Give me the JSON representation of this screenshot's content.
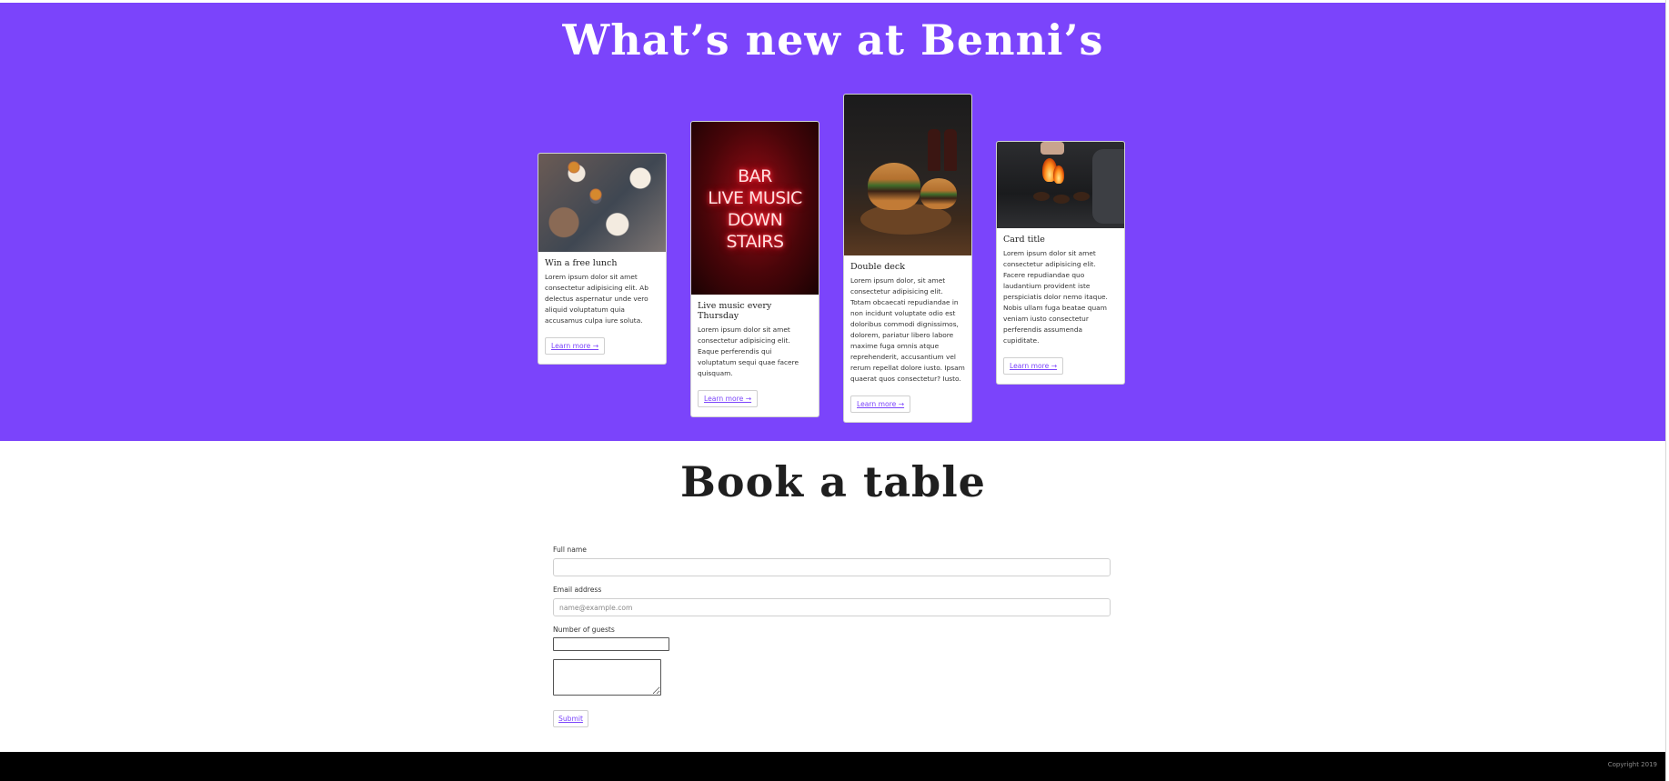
{
  "hero": {
    "title": "What’s new at Benni’s",
    "background_color": "#7b44fb"
  },
  "cards": [
    {
      "image": "friends-sharing-burgers-and-fries-photo",
      "title": "Win a free lunch",
      "text": "Lorem ipsum dolor sit amet consectetur adipisicing elit. Ab delectus aspernatur unde vero aliquid voluptatum quia accusamus culpa iure soluta.",
      "button": "Learn more →"
    },
    {
      "image": "neon-bar-sign-photo",
      "image_text": [
        "BAR",
        "LIVE MUSIC",
        "DOWN",
        "STAIRS"
      ],
      "title": "Live music every Thursday",
      "text": "Lorem ipsum dolor sit amet consectetur adipisicing elit. Eaque perferendis qui voluptatum sequi quae facere quisquam.",
      "button": "Learn more →"
    },
    {
      "image": "double-burger-on-wooden-board-photo",
      "title": "Double deck",
      "text": "Lorem ipsum dolor, sit amet consectetur adipisicing elit. Totam obcaecati repudiandae in non incidunt voluptate odio est doloribus commodi dignissimos, dolorem, pariatur libero labore maxime fuga omnis atque reprehenderit, accusantium vel rerum repellat dolore iusto. Ipsam quaerat quos consectetur? Iusto.",
      "button": "Learn more →"
    },
    {
      "image": "patties-on-flaming-grill-photo",
      "title": "Card title",
      "text": "Lorem ipsum dolor sit amet consectetur adipisicing elit. Facere repudiandae quo laudantium provident iste perspiciatis dolor nemo itaque. Nobis ullam fuga beatae quam veniam iusto consectetur perferendis assumenda cupiditate.",
      "button": "Learn more →"
    }
  ],
  "booking": {
    "title": "Book a table",
    "full_name_label": "Full name",
    "full_name_value": "",
    "email_label": "Email address",
    "email_placeholder": "name@example.com",
    "guests_label": "Number of guests",
    "guests_value": "",
    "message_value": "",
    "submit_label": "Submit"
  },
  "footer": {
    "copyright": "Copyright 2019",
    "background_color": "#000000"
  }
}
